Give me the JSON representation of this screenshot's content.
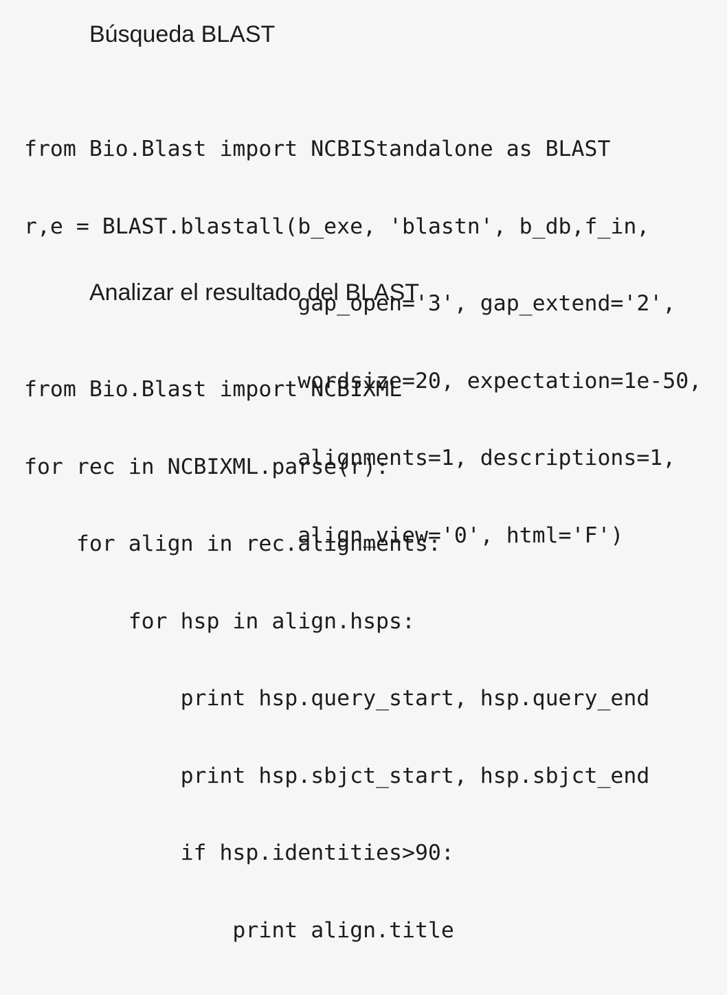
{
  "section1": {
    "heading": "Búsqueda BLAST",
    "code_lines": [
      "from Bio.Blast import NCBIStandalone as BLAST",
      "r,e = BLAST.blastall(b_exe, 'blastn', b_db,f_in,",
      "                     gap_open='3', gap_extend='2',",
      "                     wordsize=20, expectation=1e-50,",
      "                     alignments=1, descriptions=1,",
      "                     align_view='0', html='F')"
    ]
  },
  "section2": {
    "heading": "Analizar el resultado del BLAST",
    "code_lines": [
      "from Bio.Blast import NCBIXML",
      "for rec in NCBIXML.parse(r):",
      "    for align in rec.alignments:",
      "        for hsp in align.hsps:",
      "            print hsp.query_start, hsp.query_end",
      "            print hsp.sbjct_start, hsp.sbjct_end",
      "            if hsp.identities>90:",
      "                print align.title"
    ]
  }
}
